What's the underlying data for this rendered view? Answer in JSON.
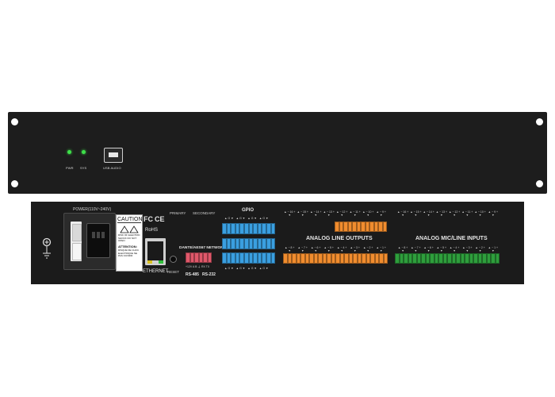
{
  "front_panel": {
    "leds": [
      {
        "label": "PWR",
        "color": "#3ee04a"
      },
      {
        "label": "SYS",
        "color": "#3ee04a"
      }
    ],
    "usb_label": "USB AUDIO"
  },
  "rear_panel": {
    "power_label": "POWER(110V~240V)",
    "caution_title": "CAUTION",
    "caution_text": "RISK OF ELECTRIC SHOCK DO NOT OPEN",
    "attention_title": "ATTENTION:",
    "attention_text": "RISQUE DE CHOC ELECTRIQUE NE PAS OUVRIR",
    "cert_fc": "FC",
    "cert_ce": "CE",
    "cert_rohs": "RoHS",
    "ethernet_label": "ETHERNET",
    "reset_label": "RESET",
    "primary_label": "PRIMARY",
    "secondary_label": "SECONDARY",
    "dante_label": "DANTE/AES67 NETWORK AUDIO",
    "serial_pins": "+12V A B ⏚ RX TX",
    "rs485_label": "RS-485",
    "rs232_label": "RS-232",
    "gpio_label": "GPIO",
    "outputs_label": "ANALOG LINE OUTPUTS",
    "inputs_label": "ANALOG MIC/LINE INPUTS",
    "output_channels_top": [
      "16",
      "15",
      "14",
      "13",
      "12",
      "11",
      "10",
      "9"
    ],
    "output_channels_bottom": [
      "8",
      "7",
      "6",
      "5",
      "4",
      "3",
      "2",
      "1"
    ],
    "input_channels_top": [
      "16",
      "15",
      "14",
      "13",
      "12",
      "11",
      "10",
      "9"
    ],
    "input_channels_bottom": [
      "8",
      "7",
      "6",
      "5",
      "4",
      "3",
      "2",
      "1"
    ],
    "colors": {
      "gpio": "#3a9fe0",
      "outputs": "#f08c2e",
      "inputs": "#2e9e3c",
      "serial": "#e0586a"
    }
  }
}
